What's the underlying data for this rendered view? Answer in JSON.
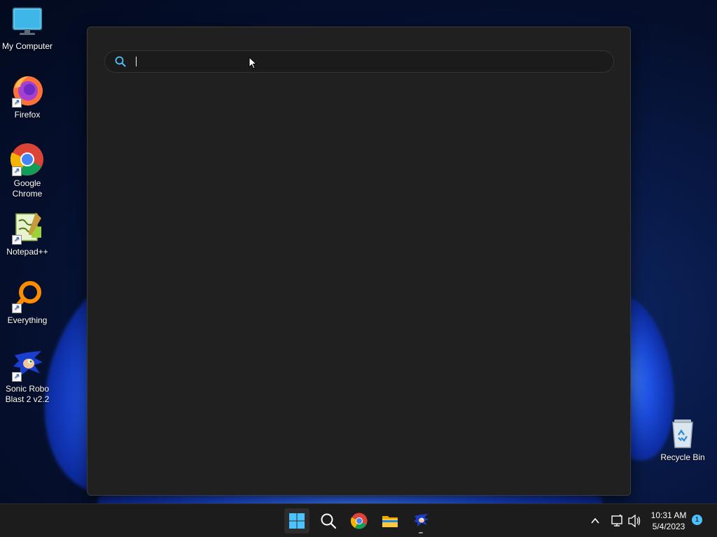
{
  "desktop": {
    "icons": [
      {
        "label": "My Computer",
        "icon": "monitor-icon"
      },
      {
        "label": "Firefox",
        "icon": "firefox-icon"
      },
      {
        "label": "Google Chrome",
        "icon": "chrome-icon"
      },
      {
        "label": "Notepad++",
        "icon": "notepadpp-icon"
      },
      {
        "label": "Everything",
        "icon": "everything-icon"
      },
      {
        "label": "Sonic Robo Blast 2 v2.2",
        "icon": "sonic-icon"
      },
      {
        "label": "Recycle Bin",
        "icon": "recycle-bin-icon"
      }
    ]
  },
  "search": {
    "value": "",
    "placeholder": ""
  },
  "taskbar": {
    "apps": [
      "start-icon",
      "search-icon",
      "chrome-icon",
      "file-explorer-icon",
      "sonic-icon"
    ],
    "clock_time": "10:31 AM",
    "clock_date": "5/4/2023",
    "notification_count": "1"
  },
  "colors": {
    "accent": "#4cc2ff",
    "window_bg": "#202020",
    "taskbar_bg": "#1c1c1c"
  }
}
